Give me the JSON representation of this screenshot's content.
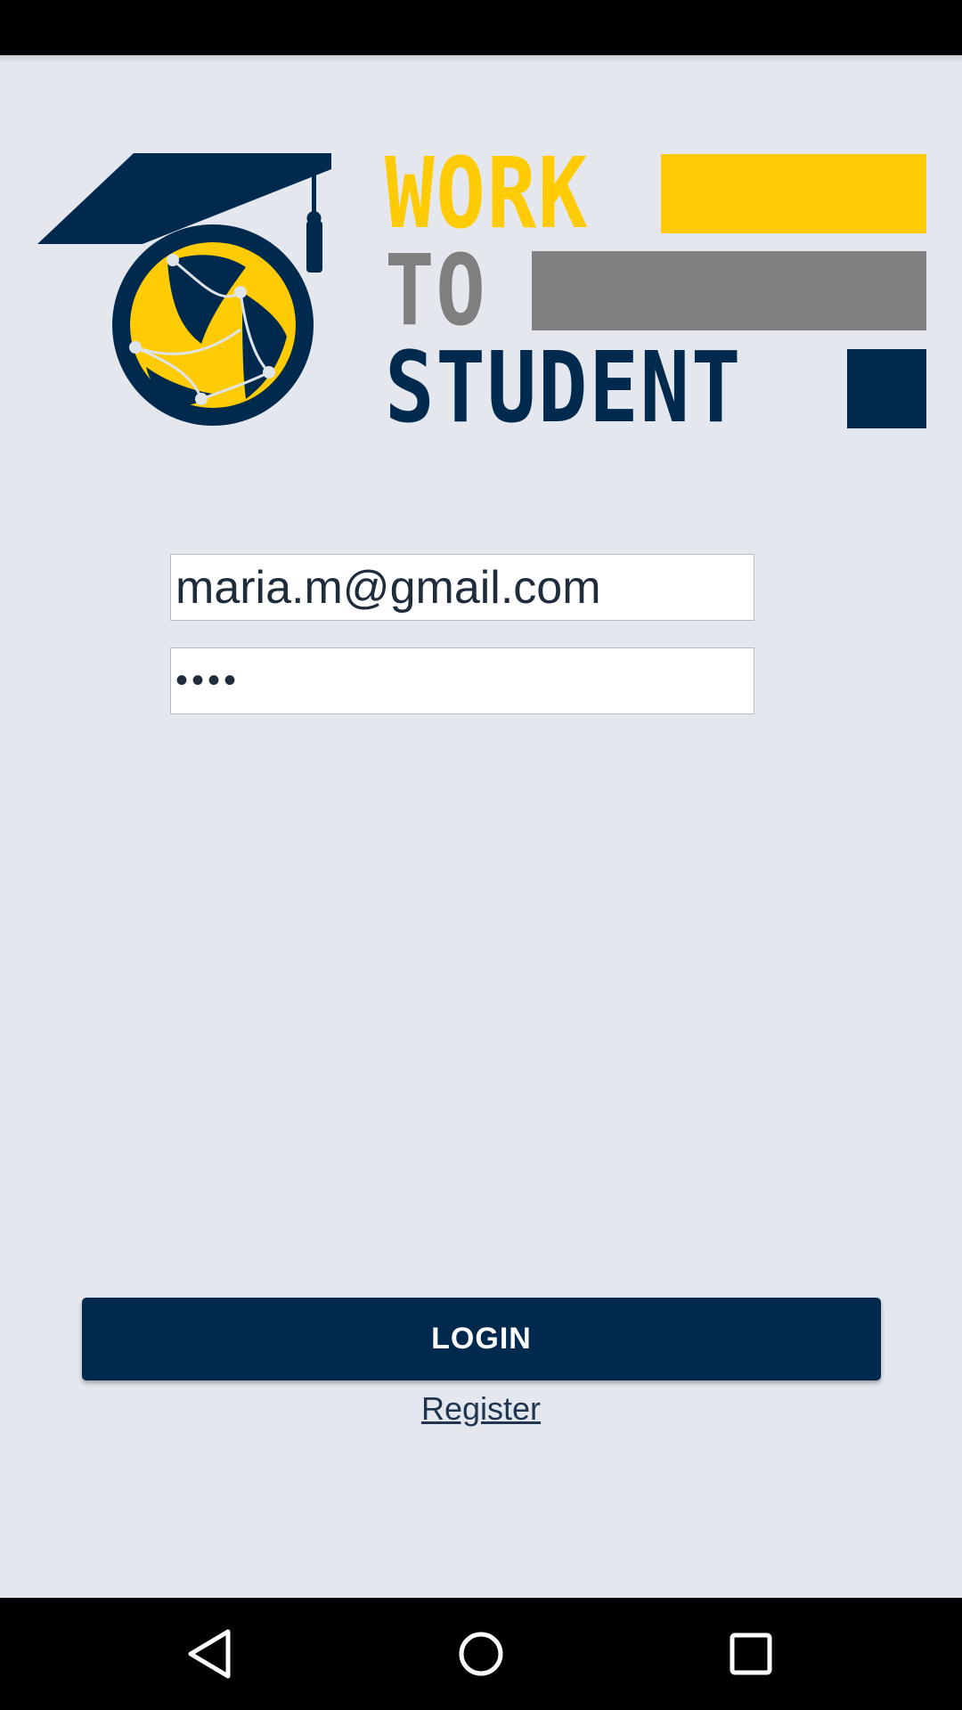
{
  "logo": {
    "line1": "WORK",
    "line2": "TO",
    "line3": "STUDENT",
    "colors": {
      "yellow": "#ffcb05",
      "gray": "#7f7f7f",
      "navy": "#002a4d"
    }
  },
  "login_form": {
    "email_value": "maria.m@gmail.com",
    "password_value": "••••"
  },
  "actions": {
    "login_label": "LOGIN",
    "register_label": "Register"
  },
  "nav_bar": {
    "icons": [
      "back-triangle-icon",
      "home-circle-icon",
      "recents-square-icon"
    ]
  },
  "theme": {
    "background": "#e4e7ee",
    "primary": "#002a4d"
  }
}
